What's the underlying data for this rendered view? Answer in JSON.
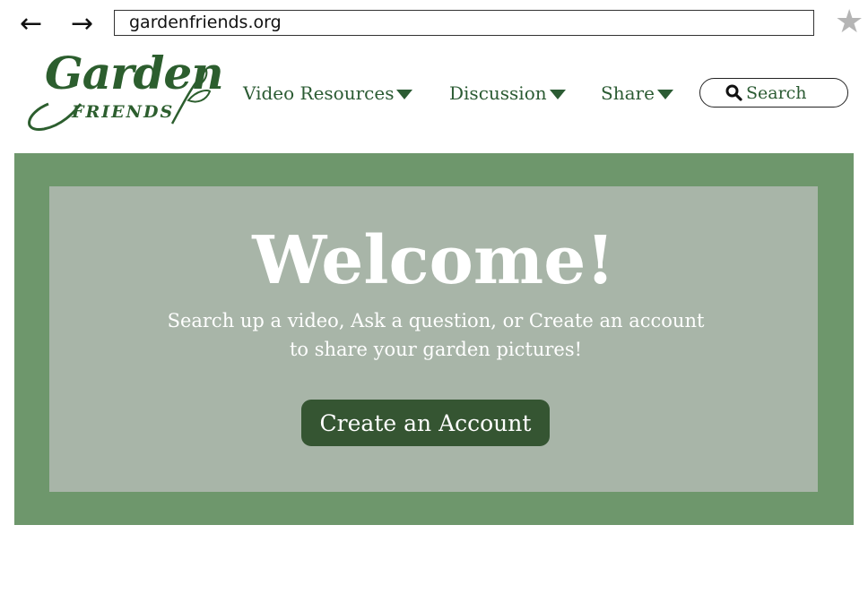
{
  "browser": {
    "back_icon": "←",
    "forward_icon": "→",
    "url": "gardenfriends.org",
    "bookmark_icon": "★"
  },
  "logo": {
    "script": "Garden",
    "sub": "FRIENDS",
    "color": "#2c5e2e"
  },
  "nav": {
    "items": [
      {
        "label": "Video Resources"
      },
      {
        "label": "Discussion"
      },
      {
        "label": "Share"
      }
    ],
    "search_label": "Search"
  },
  "hero": {
    "title": "Welcome!",
    "subtitle": "Search up a video, Ask a question, or Create an account to share your garden pictures!",
    "cta_label": "Create an Account",
    "outer_color": "#6e976c",
    "inner_color": "#a8b5a8",
    "button_color": "#355532"
  }
}
